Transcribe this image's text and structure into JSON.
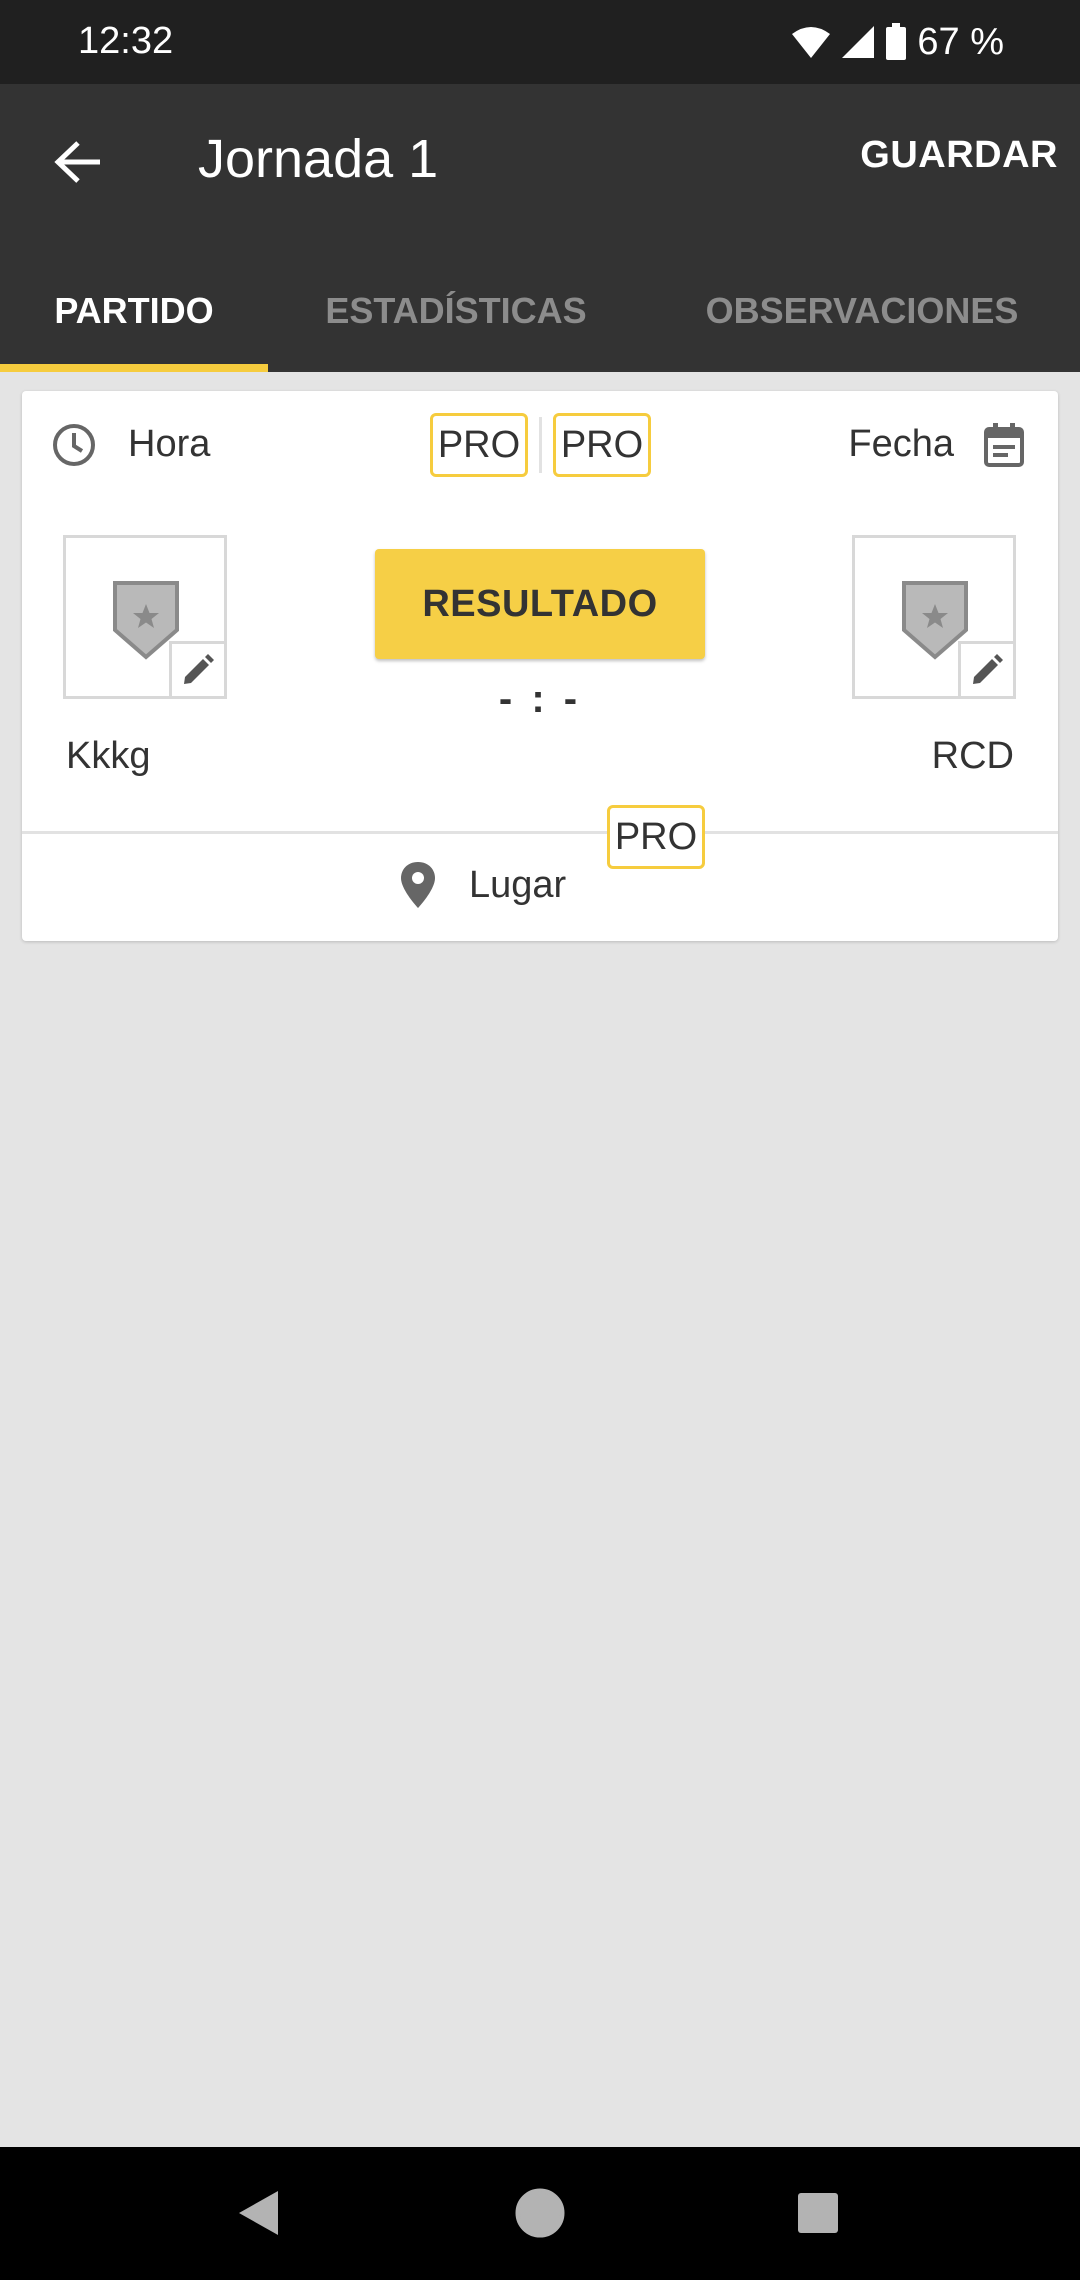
{
  "status_bar": {
    "time": "12:32",
    "battery": "67 %"
  },
  "app_bar": {
    "title": "Jornada 1",
    "save_label": "GUARDAR"
  },
  "tabs": [
    {
      "label": "PARTIDO",
      "active": true
    },
    {
      "label": "ESTADÍSTICAS",
      "active": false
    },
    {
      "label": "OBSERVACIONES",
      "active": false
    }
  ],
  "match": {
    "time_label": "Hora",
    "date_label": "Fecha",
    "pro_badges": [
      "PRO",
      "PRO"
    ],
    "home_team": "Kkkg",
    "away_team": "RCD",
    "result_label": "RESULTADO",
    "score": "- : -",
    "place_label": "Lugar",
    "place_pro_badge": "PRO"
  },
  "colors": {
    "accent": "#f6cc3e",
    "app_bar": "#333333",
    "background": "#e4e4e4"
  },
  "icons": [
    "back-arrow-icon",
    "clock-icon",
    "calendar-icon",
    "shield-icon",
    "pencil-icon",
    "location-pin-icon",
    "wifi-icon",
    "signal-icon",
    "battery-icon"
  ]
}
